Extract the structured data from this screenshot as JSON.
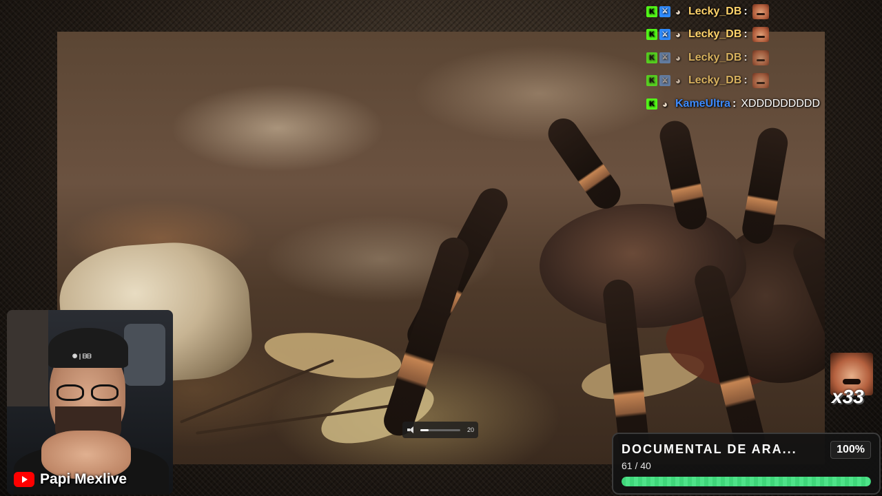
{
  "chat": {
    "messages": [
      {
        "user": "Lecky_DB",
        "user_color": "#ffd36b",
        "separator": ":",
        "text": "",
        "emote": "laughing-face-emote",
        "mod": "mod",
        "faded": false
      },
      {
        "user": "Lecky_DB",
        "user_color": "#ffd36b",
        "separator": ":",
        "text": "",
        "emote": "laughing-face-emote",
        "mod": "mod",
        "faded": false
      },
      {
        "user": "Lecky_DB",
        "user_color": "#ffd36b",
        "separator": ":",
        "text": "",
        "emote": "laughing-face-emote",
        "mod": "mod-faded",
        "faded": true
      },
      {
        "user": "Lecky_DB",
        "user_color": "#ffd36b",
        "separator": ":",
        "text": "",
        "emote": "laughing-face-emote",
        "mod": "mod-faded",
        "faded": true
      },
      {
        "user": "KameUltra",
        "user_color": "#3d8bff",
        "separator": ":",
        "text": "XDDDDDDDDD",
        "emote": "",
        "mod": "",
        "faded": false
      }
    ]
  },
  "volume": {
    "value": "20",
    "level_percent": 20
  },
  "webcam": {
    "platform_icon": "youtube-icon",
    "name": "Papi Mexlive",
    "cap_logo": "◉ | ᗷᗷ"
  },
  "combo": {
    "emote": "laughing-face-emote",
    "count": "x33"
  },
  "goal": {
    "title": "DOCUMENTAL DE ARA...",
    "percent": "100%",
    "count": "61 / 40",
    "fill_percent": 100,
    "accent": "#4ee389"
  }
}
